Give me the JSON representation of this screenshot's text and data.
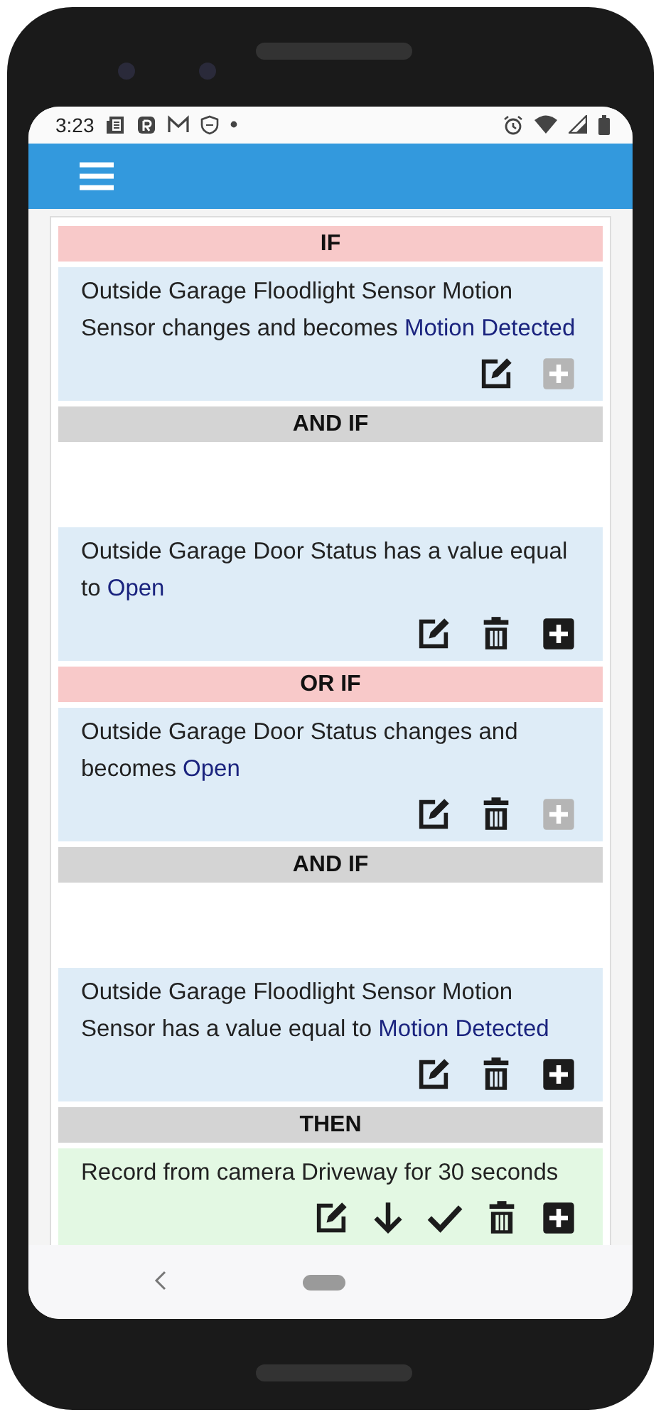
{
  "status_bar": {
    "time": "3:23"
  },
  "rules": [
    {
      "kind": "header",
      "label": "IF",
      "color": "#f8c9c9"
    },
    {
      "kind": "condition",
      "text": "Outside Garage Floodlight Sensor Motion Sensor changes and becomes ",
      "value": "Motion Detected",
      "actions": [
        {
          "kind": "edit",
          "disabled": false
        },
        {
          "kind": "add",
          "disabled": true
        }
      ]
    },
    {
      "kind": "header",
      "label": "AND IF",
      "color": "#d4d4d4"
    },
    {
      "kind": "condition",
      "text": "Outside Garage Door Status has a value equal to ",
      "value": "Open",
      "actions": [
        {
          "kind": "edit",
          "disabled": false
        },
        {
          "kind": "delete",
          "disabled": false
        },
        {
          "kind": "add",
          "disabled": false
        }
      ]
    },
    {
      "kind": "header",
      "label": "OR IF",
      "color": "#f8c9c9"
    },
    {
      "kind": "condition",
      "text": "Outside Garage Door Status changes and becomes ",
      "value": "Open",
      "actions": [
        {
          "kind": "edit",
          "disabled": false
        },
        {
          "kind": "delete",
          "disabled": false
        },
        {
          "kind": "add",
          "disabled": true
        }
      ]
    },
    {
      "kind": "header",
      "label": "AND IF",
      "color": "#d4d4d4"
    },
    {
      "kind": "condition",
      "text": "Outside Garage Floodlight Sensor Motion Sensor has a value equal to ",
      "value": "Motion Detected",
      "actions": [
        {
          "kind": "edit",
          "disabled": false
        },
        {
          "kind": "delete",
          "disabled": false
        },
        {
          "kind": "add",
          "disabled": false
        }
      ]
    },
    {
      "kind": "header",
      "label": "THEN",
      "color": "#d4d4d4"
    },
    {
      "kind": "action",
      "text": "Record from camera Driveway for 30 seconds",
      "actions": [
        {
          "kind": "edit",
          "disabled": false
        },
        {
          "kind": "down",
          "disabled": false
        },
        {
          "kind": "check",
          "disabled": false
        },
        {
          "kind": "delete",
          "disabled": false
        },
        {
          "kind": "add",
          "disabled": false
        }
      ]
    }
  ]
}
